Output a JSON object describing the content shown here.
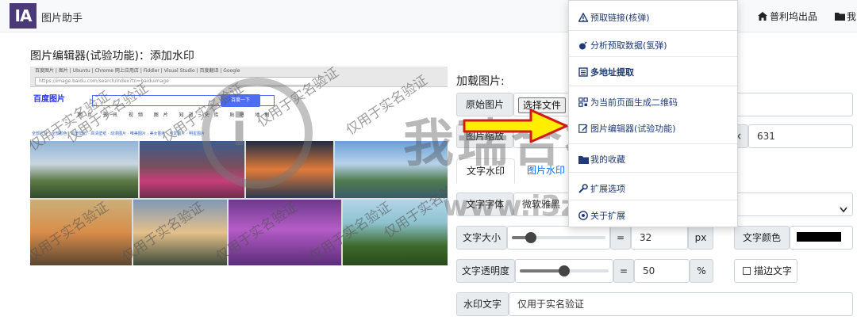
{
  "navbar": {
    "logo": "IA",
    "brand": "图片助手",
    "link_author": "普利坞出品",
    "link_my": "我的"
  },
  "page": {
    "title": "图片编辑器(试验功能)：添加水印"
  },
  "preview": {
    "browser_tabs": "百度图片 | 图片 | Ubuntu | Chrome 网上应用店 | Fiddler | Visual Studio | 百度翻译 | Google",
    "browser_url": "https://image.baidu.com/search/index?tn=baiduimage",
    "baidu_logo": "百度图片",
    "search_button": "百度一下",
    "image_tabs": "网页 资讯 视频 图片 知道 文库 贴吧 地图",
    "filters": "全部尺寸 · 全部颜色 · 风景壁纸 · 高清壁纸 · 动漫图片 · 唯美图片 · 美女图片 · 可爱图片 · 明星图片",
    "watermark_text": "仅用于实名验证"
  },
  "form": {
    "section_label": "加载图片:",
    "original_label": "原始图片",
    "choose_file": "选择文件",
    "size_label": "图片缩放",
    "size_separator": "×",
    "height_value": "631",
    "tab_text_wm": "文字水印",
    "tab_image_wm": "图片水印",
    "font_label": "文字字体",
    "font_value": "微软雅黑",
    "size_text_label": "文字大小",
    "size_eq": "=",
    "size_value": "32",
    "size_unit": "px",
    "color_label": "文字颜色",
    "opacity_label": "文字透明度",
    "opacity_eq": "=",
    "opacity_value": "50",
    "opacity_unit": "%",
    "stroke_label": "描边文字",
    "wm_text_label": "水印文字",
    "wm_text_value": "仅用于实名验证",
    "text_size_level": 0.2,
    "opacity_level": 0.5
  },
  "dropdown": {
    "items": [
      {
        "label": "预取链接(核弹)",
        "icon": "warning-icon"
      },
      {
        "label": "分析预取数据(氢弹)",
        "icon": "bomb-icon"
      },
      {
        "label": "多地址提取",
        "icon": "list-icon"
      },
      {
        "label": "为当前页面生成二维码",
        "icon": "qrcode-icon"
      },
      {
        "label": "图片编辑器(试验功能)",
        "icon": "edit-icon"
      },
      {
        "label": "我的收藏",
        "icon": "folder-icon"
      },
      {
        "label": "扩展选项",
        "icon": "wrench-icon"
      },
      {
        "label": "关于扩展",
        "icon": "info-icon"
      }
    ]
  },
  "overlay": {
    "site_name": "我瑞合社区",
    "site_url": "www.i3zh.com",
    "circle_char": "i"
  },
  "colors": {
    "logo_bg": "#4a3a77",
    "menu_text": "#1f3a74",
    "tab_link": "#0d6efd",
    "arrow_fill": "#ffee00",
    "arrow_stroke": "#d11a1a",
    "text_color_swatch": "#000000"
  }
}
